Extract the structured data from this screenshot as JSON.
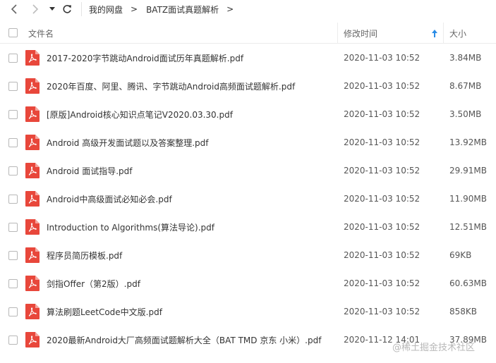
{
  "toolbar": {
    "back_icon": "chevron-left-icon",
    "forward_icon": "chevron-right-icon",
    "history_icon": "caret-down-icon",
    "refresh_icon": "refresh-icon",
    "breadcrumb": [
      "我的网盘",
      "BATZ面试真题解析"
    ],
    "separator": ">"
  },
  "header": {
    "name": "文件名",
    "modified": "修改时间",
    "size": "大小",
    "sort_indicator": "sort-up-arrow-icon",
    "sort_color": "#2a8ce6"
  },
  "files": [
    {
      "name": "2017-2020字节跳动Android面试历年真题解析.pdf",
      "modified": "2020-11-03 10:52",
      "size": "3.84MB"
    },
    {
      "name": "2020年百度、阿里、腾讯、字节跳动Android高频面试题解析.pdf",
      "modified": "2020-11-03 10:52",
      "size": "8.67MB"
    },
    {
      "name": "[原版]Android核心知识点笔记V2020.03.30.pdf",
      "modified": "2020-11-03 10:52",
      "size": "3.50MB"
    },
    {
      "name": "Android 高级开发面试题以及答案整理.pdf",
      "modified": "2020-11-03 10:52",
      "size": "13.92MB"
    },
    {
      "name": "Android 面试指导.pdf",
      "modified": "2020-11-03 10:52",
      "size": "29.91MB"
    },
    {
      "name": "Android中高级面试必知必会.pdf",
      "modified": "2020-11-03 10:52",
      "size": "11.90MB"
    },
    {
      "name": "Introduction to Algorithms(算法导论).pdf",
      "modified": "2020-11-03 10:52",
      "size": "12.51MB"
    },
    {
      "name": "程序员简历模板.pdf",
      "modified": "2020-11-03 10:52",
      "size": "69KB"
    },
    {
      "name": "剑指Offer（第2版）.pdf",
      "modified": "2020-11-03 10:52",
      "size": "60.63MB"
    },
    {
      "name": "算法刷题LeetCode中文版.pdf",
      "modified": "2020-11-03 10:52",
      "size": "858KB"
    },
    {
      "name": "2020最新Android大厂高频面试题解析大全（BAT TMD 京东 小米）.pdf",
      "modified": "2020-11-12 14:01",
      "size": "37.89MB"
    }
  ],
  "file_icon": "pdf-file-icon",
  "pdf_color": "#e8473b",
  "watermark": "@稀土掘金技术社区"
}
